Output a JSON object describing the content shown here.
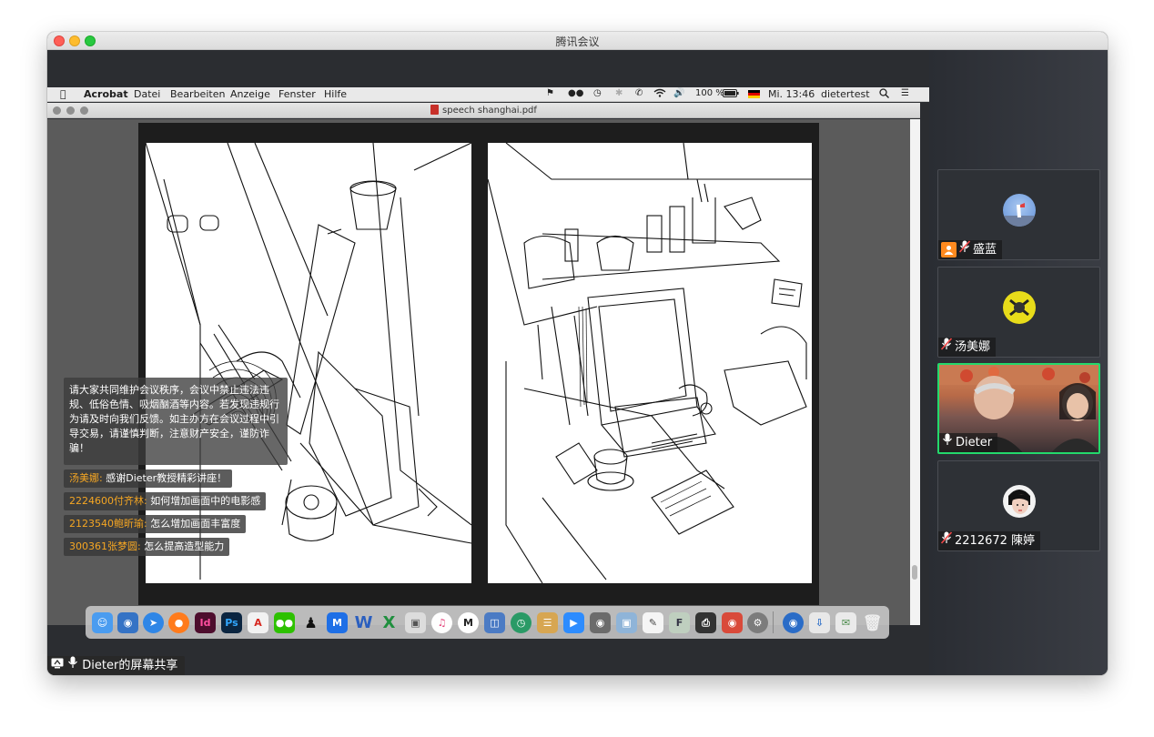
{
  "window": {
    "title": "腾讯会议"
  },
  "mac_menubar": {
    "app": "Acrobat",
    "menus": [
      "Datei",
      "Bearbeiten",
      "Anzeige",
      "Fenster",
      "Hilfe"
    ],
    "battery": "100 %",
    "clock": "Mi. 13:46",
    "user": "dietertest"
  },
  "pdf_viewer": {
    "title": "speech shanghai.pdf"
  },
  "chat": {
    "notice": "请大家共同维护会议秩序，会议中禁止违法违规、低俗色情、吸烟酗酒等内容。若发现违规行为请及时向我们反馈。如主办方在会议过程中引导交易，请谨慎判断，注意财产安全，谨防诈骗！",
    "messages": [
      {
        "name": "汤美娜:",
        "text": "感谢Dieter教授精彩讲座！"
      },
      {
        "name": "2224600付齐林:",
        "text": "如何增加画面中的电影感"
      },
      {
        "name": "2123540鲍昕瑜:",
        "text": "怎么增加画面丰富度"
      },
      {
        "name": "300361张梦圆:",
        "text": "怎么提高造型能力"
      }
    ]
  },
  "share_label": "Dieter的屏幕共享",
  "participants": [
    {
      "name": "盛蓝",
      "role": "host",
      "mic": "muted"
    },
    {
      "name": "汤美娜",
      "mic": "muted"
    },
    {
      "name": "Dieter",
      "mic": "on",
      "video": true,
      "active": true
    },
    {
      "name": "2212672 陳婷",
      "mic": "muted"
    }
  ],
  "dock_icons": [
    "finder-icon",
    "migration-icon",
    "safari-icon",
    "firefox-icon",
    "indesign-icon",
    "photoshop-icon",
    "acrobat-icon",
    "wechat-icon",
    "qq-icon",
    "tencent-meeting-icon",
    "word-icon",
    "excel-icon",
    "preview-icon",
    "itunes-icon",
    "maps-icon",
    "archive-icon",
    "time-machine-icon",
    "notes-icon",
    "zoom-icon",
    "screenshot-icon",
    "photos-icon",
    "textedit-icon",
    "font-icon",
    "printer-icon",
    "color-icon",
    "settings-icon",
    "network-icon",
    "downloads-icon",
    "mail-icon",
    "trash-icon"
  ],
  "colors": {
    "accent_active": "#23d96c",
    "chat_name": "#f5a623",
    "host_badge": "#ff8a1f"
  }
}
